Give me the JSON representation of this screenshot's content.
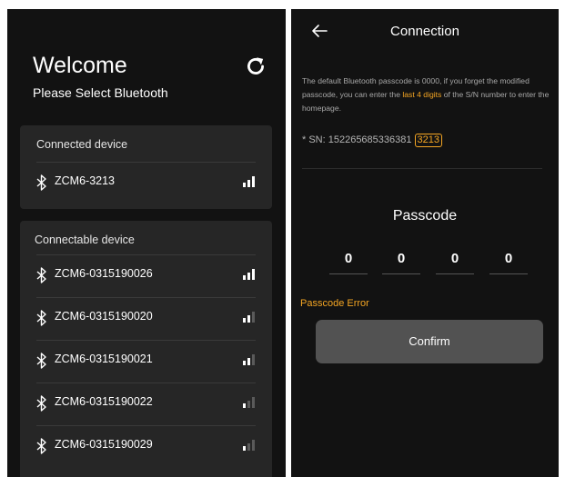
{
  "device_list": {
    "title": "Welcome",
    "subtitle": "Please Select Bluetooth",
    "connected": {
      "header": "Connected device",
      "devices": [
        {
          "name": "ZCM6-3213",
          "signal_bars": 3
        }
      ]
    },
    "connectable": {
      "header": "Connectable device",
      "devices": [
        {
          "name": "ZCM6-0315190026",
          "signal_bars": 3
        },
        {
          "name": "ZCM6-0315190020",
          "signal_bars": 2
        },
        {
          "name": "ZCM6-0315190021",
          "signal_bars": 2
        },
        {
          "name": "ZCM6-0315190022",
          "signal_bars": 1
        },
        {
          "name": "ZCM6-0315190029",
          "signal_bars": 1
        }
      ]
    },
    "icons": {
      "refresh": "refresh-icon",
      "bluetooth": "bluetooth-icon",
      "signal": "signal-strength-icon"
    }
  },
  "connection": {
    "title": "Connection",
    "info_before": "The default Bluetooth passcode is 0000, if you forget the modified passcode, you can enter the ",
    "info_highlight": "last 4 digits",
    "info_after": " of the S/N number to enter the homepage.",
    "sn_label": "* SN: 152265685336381",
    "sn_suffix": "3213",
    "passcode_label": "Passcode",
    "digits": [
      "0",
      "0",
      "0",
      "0"
    ],
    "error": "Passcode Error",
    "confirm_label": "Confirm",
    "icons": {
      "back": "back-arrow-icon"
    }
  },
  "colors": {
    "background": "#121212",
    "card": "#262626",
    "accent": "#f5a623",
    "button": "#525252",
    "text": "#ffffff",
    "muted": "#a8a8a8"
  }
}
